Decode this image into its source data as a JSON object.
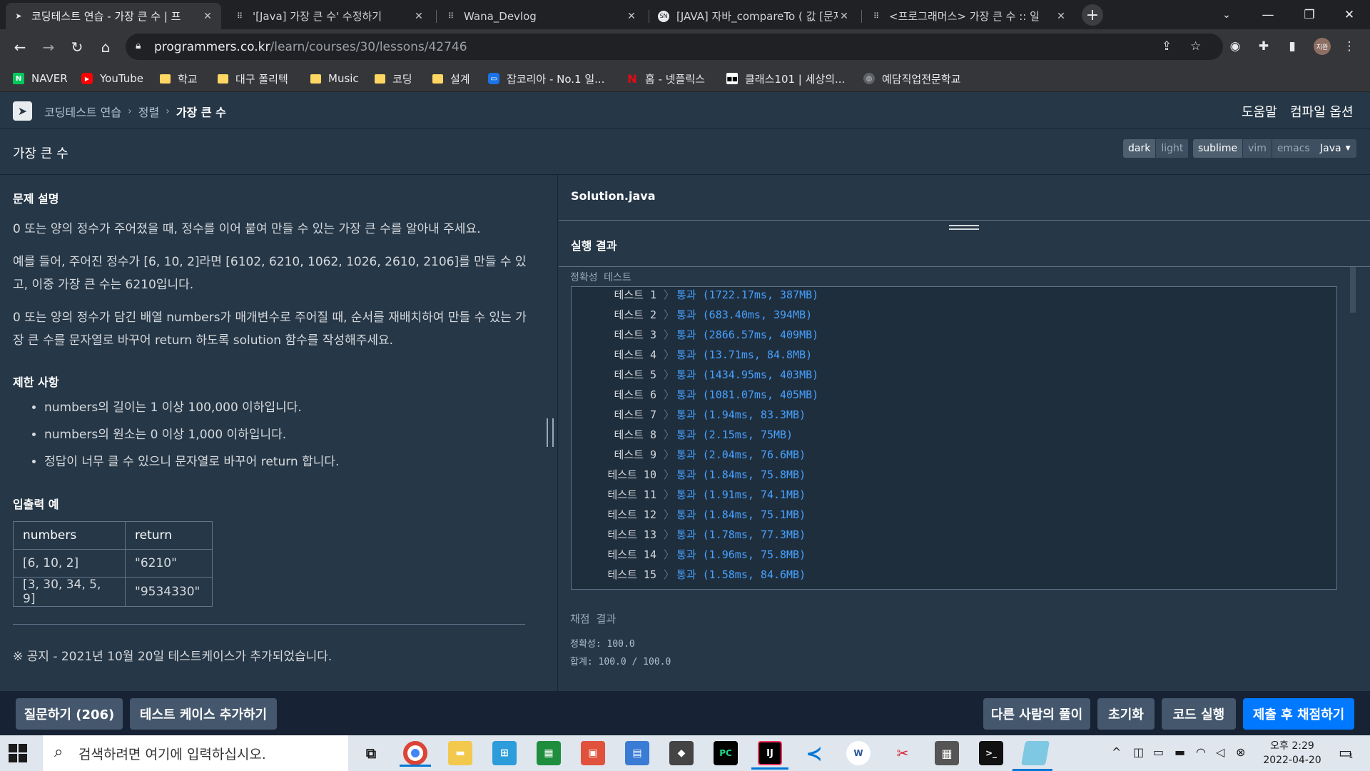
{
  "browser": {
    "tabs": [
      {
        "title": "코딩테스트 연습 - 가장 큰 수 | 프",
        "icon": "programmers-icon"
      },
      {
        "title": "'[Java] 가장 큰 수' 수정하기",
        "icon": "velog-icon"
      },
      {
        "title": "Wana_Devlog",
        "icon": "velog-icon"
      },
      {
        "title": "[JAVA] 자바_compareTo ( 값 [문자",
        "icon": "page-icon"
      },
      {
        "title": "<프로그래머스> 가장 큰 수 :: 일",
        "icon": "tistory-icon"
      }
    ],
    "url_host": "programmers.co.kr",
    "url_path": "/learn/courses/30/lessons/42746",
    "profile_initials": "지완",
    "bookmarks": [
      {
        "label": "NAVER",
        "icon": "naver-icon"
      },
      {
        "label": "YouTube",
        "icon": "youtube-icon"
      },
      {
        "label": "학교",
        "icon": "folder-icon"
      },
      {
        "label": "대구 폴리텍",
        "icon": "folder-icon"
      },
      {
        "label": "Music",
        "icon": "folder-icon"
      },
      {
        "label": "코딩",
        "icon": "folder-icon"
      },
      {
        "label": "설계",
        "icon": "folder-icon"
      },
      {
        "label": "잡코리아 - No.1 일...",
        "icon": "jobkorea-icon"
      },
      {
        "label": "홈 - 넷플릭스",
        "icon": "netflix-icon"
      },
      {
        "label": "클래스101 | 세상의...",
        "icon": "class101-icon"
      },
      {
        "label": "예담직업전문학교",
        "icon": "globe-icon"
      }
    ]
  },
  "header": {
    "breadcrumb": [
      "코딩테스트 연습",
      "정렬",
      "가장 큰 수"
    ],
    "help": "도움말",
    "compile_options": "컴파일 옵션"
  },
  "problem": {
    "title": "가장 큰 수",
    "editor_theme": [
      "dark",
      "light"
    ],
    "editor_keymap": [
      "sublime",
      "vim",
      "emacs"
    ],
    "language": "Java",
    "desc_heading": "문제 설명",
    "desc": [
      "0 또는 양의 정수가 주어졌을 때, 정수를 이어 붙여 만들 수 있는 가장 큰 수를 알아내 주세요.",
      "예를 들어, 주어진 정수가 [6, 10, 2]라면 [6102, 6210, 1062, 1026, 2610, 2106]를 만들 수 있고, 이중 가장 큰 수는 6210입니다.",
      "0 또는 양의 정수가 담긴 배열 numbers가 매개변수로 주어질 때, 순서를 재배치하여 만들 수 있는 가장 큰 수를 문자열로 바꾸어 return 하도록 solution 함수를 작성해주세요."
    ],
    "constraints_heading": "제한 사항",
    "constraints": [
      "numbers의 길이는 1 이상 100,000 이하입니다.",
      "numbers의 원소는 0 이상 1,000 이하입니다.",
      "정답이 너무 클 수 있으니 문자열로 바꾸어 return 합니다."
    ],
    "io_heading": "입출력 예",
    "io_headers": [
      "numbers",
      "return"
    ],
    "io_rows": [
      [
        "[6, 10, 2]",
        "\"6210\""
      ],
      [
        "[3, 30, 34, 5, 9]",
        "\"9534330\""
      ]
    ],
    "notice": "※ 공지 - 2021년 10월 20일 테스트케이스가 추가되었습니다."
  },
  "editor": {
    "filename": "Solution.java",
    "result_heading": "실행 결과",
    "result_label": "정확성  테스트",
    "tests": [
      {
        "name": "테스트 1",
        "result": "통과 (1722.17ms, 387MB)"
      },
      {
        "name": "테스트 2",
        "result": "통과 (683.40ms, 394MB)"
      },
      {
        "name": "테스트 3",
        "result": "통과 (2866.57ms, 409MB)"
      },
      {
        "name": "테스트 4",
        "result": "통과 (13.71ms, 84.8MB)"
      },
      {
        "name": "테스트 5",
        "result": "통과 (1434.95ms, 403MB)"
      },
      {
        "name": "테스트 6",
        "result": "통과 (1081.07ms, 405MB)"
      },
      {
        "name": "테스트 7",
        "result": "통과 (1.94ms, 83.3MB)"
      },
      {
        "name": "테스트 8",
        "result": "통과 (2.15ms, 75MB)"
      },
      {
        "name": "테스트 9",
        "result": "통과 (2.04ms, 76.6MB)"
      },
      {
        "name": "테스트 10",
        "result": "통과 (1.84ms, 75.8MB)"
      },
      {
        "name": "테스트 11",
        "result": "통과 (1.91ms, 74.1MB)"
      },
      {
        "name": "테스트 12",
        "result": "통과 (1.84ms, 75.1MB)"
      },
      {
        "name": "테스트 13",
        "result": "통과 (1.78ms, 77.3MB)"
      },
      {
        "name": "테스트 14",
        "result": "통과 (1.96ms, 75.8MB)"
      },
      {
        "name": "테스트 15",
        "result": "통과 (1.58ms, 84.6MB)"
      }
    ],
    "grading_heading": "채점 결과",
    "accuracy": "정확성: 100.0",
    "total": "합계: 100.0 / 100.0"
  },
  "actions": {
    "ask": "질문하기 (206)",
    "add_testcase": "테스트 케이스 추가하기",
    "others": "다른 사람의 풀이",
    "reset": "초기화",
    "run": "코드 실행",
    "submit": "제출 후 채점하기"
  },
  "taskbar": {
    "search_placeholder": "검색하려면 여기에 입력하십시오.",
    "time": "오후 2:29",
    "date": "2022-04-20",
    "notification_count": "1"
  }
}
